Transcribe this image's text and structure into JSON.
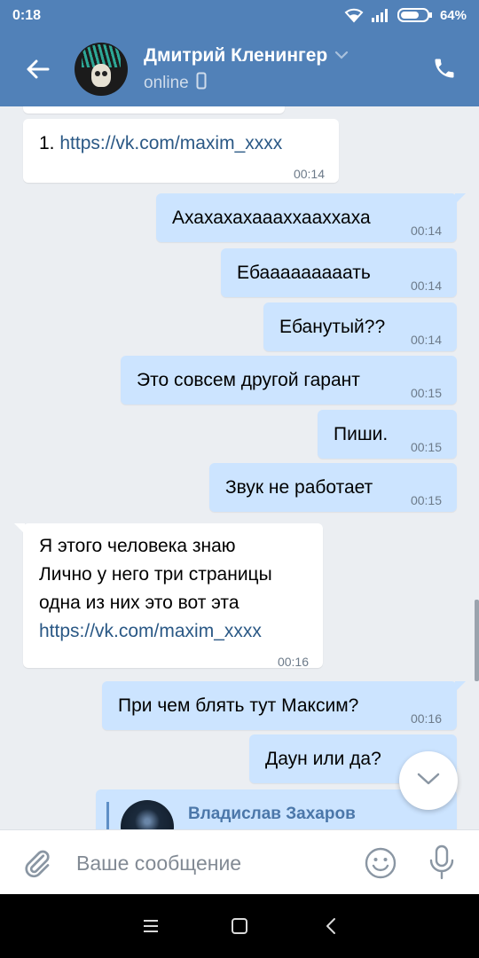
{
  "status_bar": {
    "time": "0:18",
    "battery": "64%"
  },
  "header": {
    "name": "Дмитрий Кленингер",
    "status": "online"
  },
  "messages": [
    {
      "dir": "in",
      "prefix": "1. ",
      "link": "https://vk.com/maxim_xxxx",
      "time": "00:14"
    },
    {
      "dir": "out",
      "text": "Ахахахахаааххааххаха",
      "time": "00:14"
    },
    {
      "dir": "out",
      "text": "Ебааааааааать",
      "time": "00:14"
    },
    {
      "dir": "out",
      "text": "Ебанутый??",
      "time": "00:14"
    },
    {
      "dir": "out",
      "text": "Это совсем другой гарант",
      "time": "00:15"
    },
    {
      "dir": "out",
      "text": "Пиши.",
      "time": "00:15"
    },
    {
      "dir": "out",
      "text": "Звук не работает",
      "time": "00:15"
    },
    {
      "dir": "in",
      "lines": [
        "Я этого человека знаю",
        "Лично у него три страницы",
        "одна из них это вот эта"
      ],
      "link": "https://vk.com/maxim_xxxx",
      "time": "00:16"
    },
    {
      "dir": "out",
      "text": "При чем блять тут Максим?",
      "time": "00:16"
    },
    {
      "dir": "out",
      "text": "Даун или да?",
      "time": ""
    },
    {
      "dir": "out",
      "forward_author": "Владислав Захаров"
    }
  ],
  "composer": {
    "placeholder": "Ваше сообщение"
  },
  "colors": {
    "header": "#5181b8",
    "outgoing_bubble": "#cce4ff",
    "incoming_bubble": "#ffffff",
    "link": "#2a5885",
    "background": "#ebeef2"
  },
  "icons": [
    "back-arrow-icon",
    "chevron-down-icon",
    "phone-icon",
    "mobile-icon",
    "attach-icon",
    "emoji-icon",
    "microphone-icon",
    "scroll-down-icon",
    "menu-icon",
    "home-icon",
    "nav-back-icon",
    "wifi-icon",
    "signal-icon",
    "battery-icon"
  ]
}
